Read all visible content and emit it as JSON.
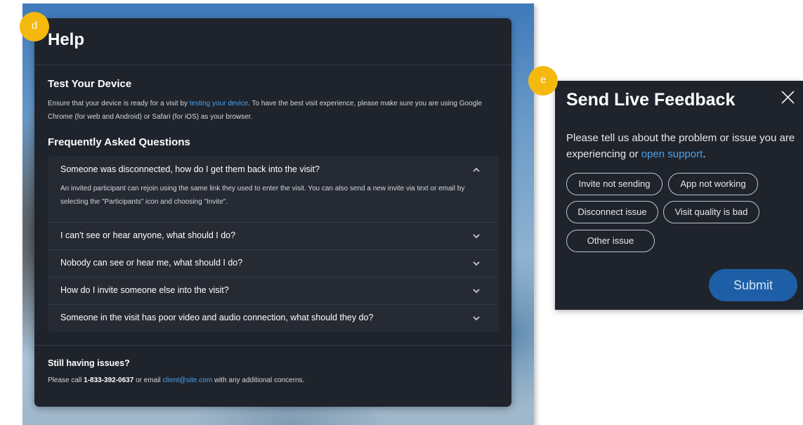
{
  "help": {
    "badge": "d",
    "title": "Help",
    "test_device": {
      "heading": "Test Your Device",
      "text_before_link": "Ensure that your device is ready for a visit by ",
      "link": "testing your device",
      "text_after_link": ". To have the best visit experience, please make sure you are using Google Chrome (for web and Android) or Safari (for iOS) as your browser."
    },
    "faq": {
      "heading": "Frequently Asked Questions",
      "items": [
        {
          "question": "Someone was disconnected, how do I get them back into the visit?",
          "expanded": true,
          "answer": "An invited participant can rejoin using the same link they used to enter the visit. You can also send a new invite via text or email by selecting the \"Participants\" icon and choosing \"Invite\"."
        },
        {
          "question": "I can't see or hear anyone, what should I do?",
          "expanded": false
        },
        {
          "question": "Nobody can see or hear me, what should I do?",
          "expanded": false
        },
        {
          "question": "How do I invite someone else into the visit?",
          "expanded": false
        },
        {
          "question": "Someone in the visit has poor video and audio connection, what should they do?",
          "expanded": false
        }
      ]
    },
    "footer": {
      "heading": "Still having issues?",
      "text_before_phone": "Please call ",
      "phone": "1-833-392-0637",
      "text_between": " or email ",
      "email": "client@site.com",
      "text_after": " with any additional concerns."
    }
  },
  "feedback": {
    "badge": "e",
    "title": "Send Live Feedback",
    "prompt_before_link": "Please tell us about the problem or issue you are experiencing or ",
    "prompt_link": "open support",
    "prompt_after_link": ".",
    "options": [
      "Invite not sending",
      "App not working",
      "Disconnect issue",
      "Visit quality is bad",
      "Other issue"
    ],
    "submit_label": "Submit"
  },
  "icons": {
    "close": "close-icon",
    "expand": "chevron-down-icon",
    "collapse": "chevron-up-icon"
  },
  "colors": {
    "panel_bg": "#1f232b",
    "link": "#4aa3ec",
    "badge": "#f5b90e",
    "submit": "#1e5ea6"
  }
}
